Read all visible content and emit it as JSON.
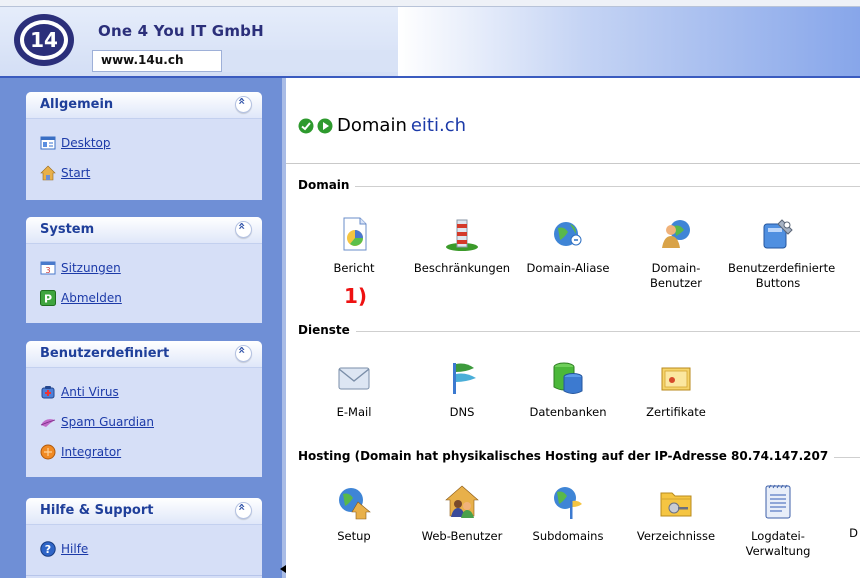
{
  "header": {
    "company": "One 4 You IT GmbH",
    "url": "www.14u.ch"
  },
  "sidebar": {
    "panels": [
      {
        "title": "Allgemein",
        "items": [
          {
            "label": "Desktop",
            "icon": "desktop-icon"
          },
          {
            "label": "Start",
            "icon": "home-icon"
          }
        ]
      },
      {
        "title": "System",
        "items": [
          {
            "label": "Sitzungen",
            "icon": "sessions-icon"
          },
          {
            "label": "Abmelden",
            "icon": "logout-icon"
          }
        ]
      },
      {
        "title": "Benutzerdefiniert",
        "items": [
          {
            "label": "Anti Virus",
            "icon": "antivirus-icon"
          },
          {
            "label": "Spam Guardian",
            "icon": "spam-guardian-icon"
          },
          {
            "label": "Integrator",
            "icon": "integrator-icon"
          }
        ]
      },
      {
        "title": "Hilfe & Support",
        "items": [
          {
            "label": "Hilfe",
            "icon": "help-icon"
          }
        ]
      }
    ]
  },
  "main": {
    "title_prefix": "Domain",
    "domain": "eiti.ch",
    "marker": "1)",
    "sections": [
      {
        "title": "Domain",
        "tools": [
          {
            "label": "Bericht",
            "icon": "report-icon"
          },
          {
            "label": "Beschränkungen",
            "icon": "limits-icon"
          },
          {
            "label": "Domain-Aliase",
            "icon": "domain-alias-icon"
          },
          {
            "label": "Domain-Benutzer",
            "icon": "domain-users-icon"
          },
          {
            "label": "Benutzerdefinierte Buttons",
            "icon": "custom-buttons-icon"
          }
        ]
      },
      {
        "title": "Dienste",
        "tools": [
          {
            "label": "E-Mail",
            "icon": "mail-icon"
          },
          {
            "label": "DNS",
            "icon": "dns-icon"
          },
          {
            "label": "Datenbanken",
            "icon": "database-icon"
          },
          {
            "label": "Zertifikate",
            "icon": "certificate-icon"
          }
        ]
      },
      {
        "title": "Hosting (Domain hat physikalisches Hosting auf der IP-Adresse 80.74.147.207",
        "tools": [
          {
            "label": "Setup",
            "icon": "setup-icon"
          },
          {
            "label": "Web-Benutzer",
            "icon": "web-users-icon"
          },
          {
            "label": "Subdomains",
            "icon": "subdomains-icon"
          },
          {
            "label": "Verzeichnisse",
            "icon": "directories-icon"
          },
          {
            "label": "Logdatei-Verwaltung",
            "icon": "log-management-icon"
          },
          {
            "label": "D",
            "icon": "cut-off-icon"
          }
        ]
      }
    ]
  }
}
